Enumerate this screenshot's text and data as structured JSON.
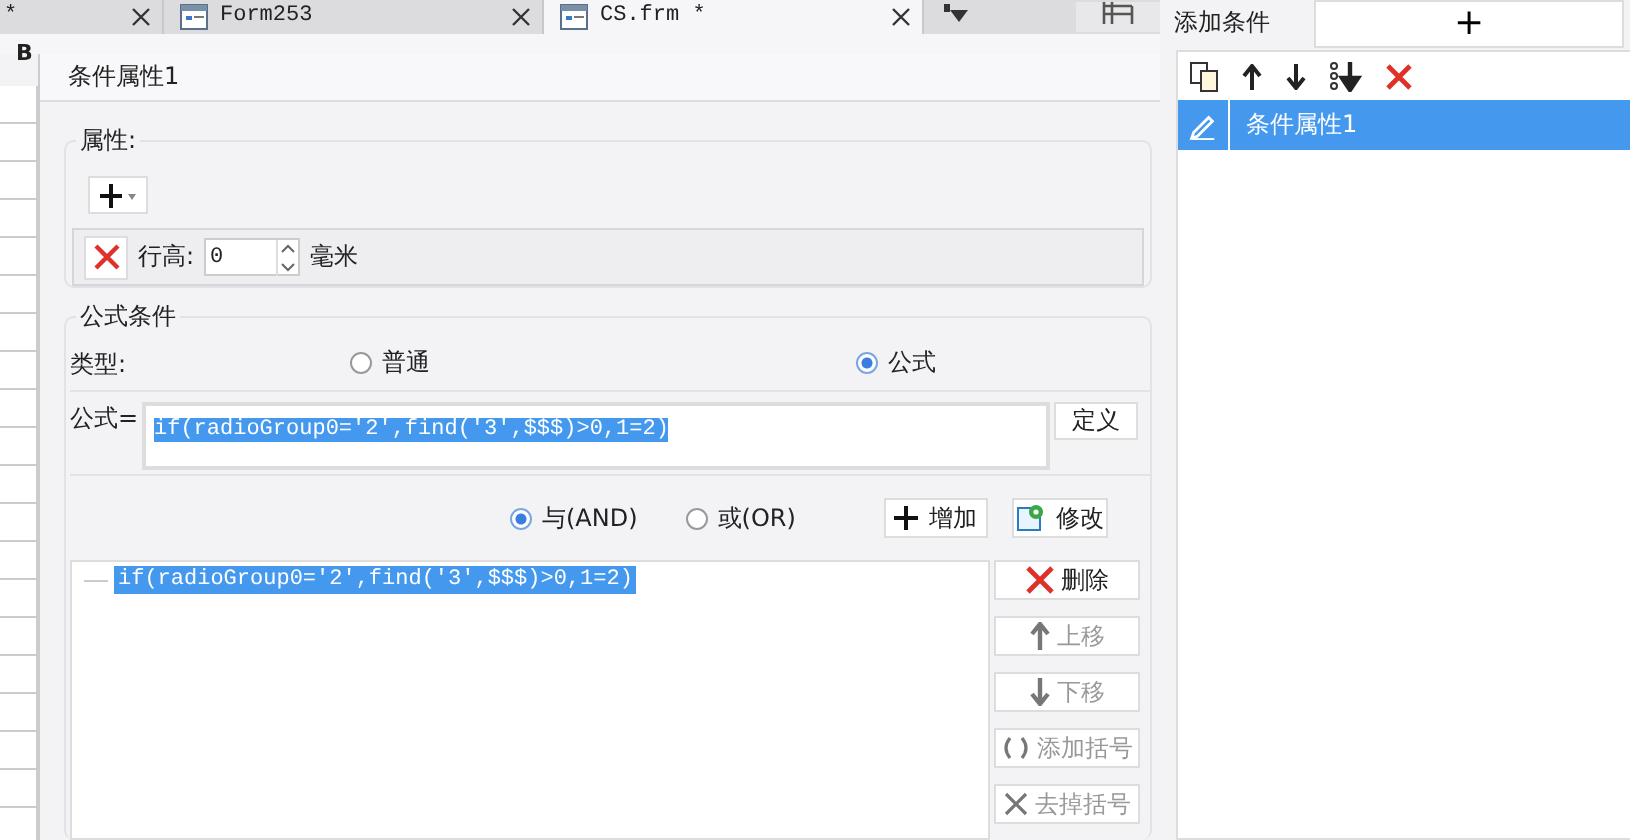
{
  "editor_tabs": [
    {
      "label": "*",
      "selected": false
    },
    {
      "label": "Form253",
      "selected": false
    },
    {
      "label": "CS.frm *",
      "selected": true
    }
  ],
  "toolbar": {
    "bold_label": "B"
  },
  "dialog": {
    "title": "条件属性1",
    "attributes": {
      "legend": "属性:",
      "rows": [
        {
          "label": "行高:",
          "value": "0",
          "unit": "毫米"
        }
      ]
    },
    "formula_condition": {
      "legend": "公式条件",
      "type_label": "类型:",
      "types": [
        {
          "label": "普通",
          "selected": false
        },
        {
          "label": "公式",
          "selected": true
        }
      ],
      "formula_label": "公式=",
      "formula_value": "if(radioGroup0='2',find('3',$$$)>0,1=2)",
      "define_button": "定义",
      "logic": [
        {
          "label": "与(AND)",
          "selected": true
        },
        {
          "label": "或(OR)",
          "selected": false
        }
      ],
      "add_button": "增加",
      "modify_button": "修改",
      "conditions": [
        {
          "text": "if(radioGroup0='2',find('3',$$$)>0,1=2)",
          "selected": true
        }
      ],
      "actions": [
        {
          "label": "删除",
          "kind": "delete",
          "disabled": false
        },
        {
          "label": "上移",
          "kind": "up",
          "disabled": true
        },
        {
          "label": "下移",
          "kind": "down",
          "disabled": true
        },
        {
          "label": "添加括号",
          "kind": "add-paren",
          "disabled": true
        },
        {
          "label": "去掉括号",
          "kind": "remove-paren",
          "disabled": true
        }
      ]
    }
  },
  "right_panel": {
    "tab_label": "添加条件",
    "add_button": "+",
    "items": [
      {
        "label": "条件属性1",
        "selected": true
      }
    ]
  }
}
